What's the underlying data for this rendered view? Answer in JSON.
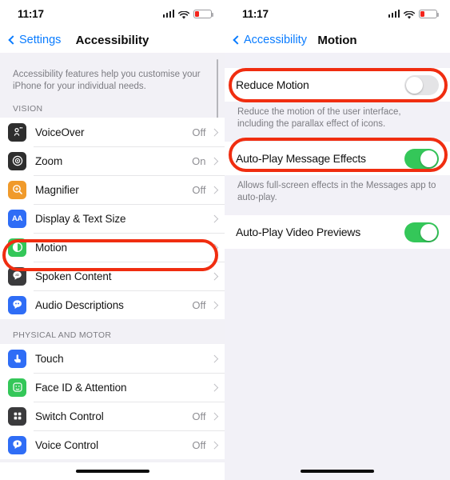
{
  "left_phone": {
    "status": {
      "time": "11:17",
      "signal_icon": "cellular-bars-icon",
      "wifi_icon": "wifi-icon",
      "battery_icon": "battery-low-icon"
    },
    "nav": {
      "back_label": "Settings",
      "title": "Accessibility"
    },
    "blurb": "Accessibility features help you customise your iPhone for your individual needs.",
    "sections": [
      {
        "header": "VISION",
        "rows": [
          {
            "label": "VoiceOver",
            "value": "Off",
            "icon": "voiceover-icon",
            "icon_color": "#2e2e2e",
            "highlighted": false
          },
          {
            "label": "Zoom",
            "value": "On",
            "icon": "zoom-icon",
            "icon_color": "#2e2e2e",
            "highlighted": false
          },
          {
            "label": "Magnifier",
            "value": "Off",
            "icon": "magnifier-icon",
            "icon_color": "#f09a2b",
            "highlighted": false
          },
          {
            "label": "Display & Text Size",
            "value": "",
            "icon": "display-text-size-icon",
            "icon_color": "#2f6df6",
            "highlighted": false
          },
          {
            "label": "Motion",
            "value": "",
            "icon": "motion-icon",
            "icon_color": "#34c759",
            "highlighted": true
          },
          {
            "label": "Spoken Content",
            "value": "",
            "icon": "spoken-content-icon",
            "icon_color": "#3a3a3c",
            "highlighted": false
          },
          {
            "label": "Audio Descriptions",
            "value": "Off",
            "icon": "audio-descriptions-icon",
            "icon_color": "#2f6df6",
            "highlighted": false
          }
        ]
      },
      {
        "header": "PHYSICAL AND MOTOR",
        "rows": [
          {
            "label": "Touch",
            "value": "",
            "icon": "touch-icon",
            "icon_color": "#2f6df6",
            "highlighted": false
          },
          {
            "label": "Face ID & Attention",
            "value": "",
            "icon": "face-id-icon",
            "icon_color": "#34c759",
            "highlighted": false
          },
          {
            "label": "Switch Control",
            "value": "Off",
            "icon": "switch-control-icon",
            "icon_color": "#3a3a3c",
            "highlighted": false
          },
          {
            "label": "Voice Control",
            "value": "Off",
            "icon": "voice-control-icon",
            "icon_color": "#2f6df6",
            "highlighted": false
          }
        ]
      }
    ]
  },
  "right_phone": {
    "status": {
      "time": "11:17",
      "signal_icon": "cellular-bars-icon",
      "wifi_icon": "wifi-icon",
      "battery_icon": "battery-low-icon"
    },
    "nav": {
      "back_label": "Accessibility",
      "title": "Motion"
    },
    "settings": [
      {
        "label": "Reduce Motion",
        "state": "off",
        "footnote": "Reduce the motion of the user interface, including the parallax effect of icons.",
        "highlighted": true
      },
      {
        "label": "Auto-Play Message Effects",
        "state": "on",
        "footnote": "Allows full-screen effects in the Messages app to auto-play.",
        "highlighted": true
      },
      {
        "label": "Auto-Play Video Previews",
        "state": "on",
        "footnote": "",
        "highlighted": false
      }
    ]
  },
  "annotation": {
    "color": "#f02d10",
    "shape": "rounded-oval-outline"
  }
}
